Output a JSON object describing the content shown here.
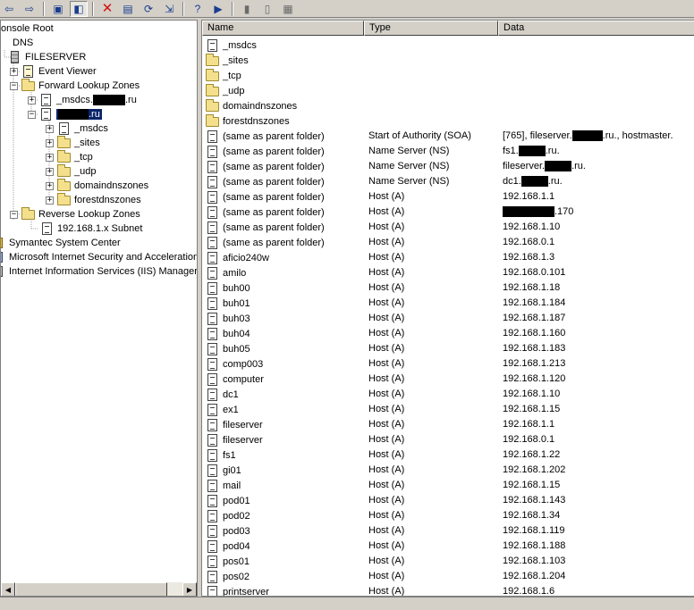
{
  "toolbar": {
    "buttons": [
      {
        "icon": "back-arrow-icon",
        "glyph": "⇦"
      },
      {
        "icon": "forward-arrow-icon",
        "glyph": "⇨"
      },
      {
        "icon": "up-one-level-icon",
        "glyph": "▣"
      },
      {
        "icon": "show-hide-console-tree-icon",
        "glyph": "◧"
      },
      {
        "icon": "delete-icon",
        "glyph": "✕"
      },
      {
        "icon": "properties-icon",
        "glyph": "▤"
      },
      {
        "icon": "refresh-icon",
        "glyph": "⟳"
      },
      {
        "icon": "export-list-icon",
        "glyph": "⇲"
      },
      {
        "icon": "help-icon",
        "glyph": "?"
      },
      {
        "icon": "action-pane-icon",
        "glyph": "▶"
      },
      {
        "icon": "new-host-icon",
        "glyph": "▮"
      },
      {
        "icon": "new-record-icon",
        "glyph": "▯"
      },
      {
        "icon": "new-zone-icon",
        "glyph": "▦"
      }
    ]
  },
  "tree": {
    "console_root": "onsole Root",
    "dns": "DNS",
    "server": "FILESERVER",
    "event_viewer": "Event Viewer",
    "forward_lookup_zones": "Forward Lookup Zones",
    "msdcs_zone_prefix": "_msdcs.",
    "msdcs_zone_suffix": ".ru",
    "selected_zone_suffix": ".ru",
    "sub_msdcs": "_msdcs",
    "sub_sites": "_sites",
    "sub_tcp": "_tcp",
    "sub_udp": "_udp",
    "sub_domaindnszones": "domaindnszones",
    "sub_forestdnszones": "forestdnszones",
    "reverse_lookup_zones": "Reverse Lookup Zones",
    "reverse_subnet": "192.168.1.x Subnet",
    "symantec": "Symantec System Center",
    "isa": "Microsoft Internet Security and Acceleration",
    "iis": "Internet Information Services (IIS) Manager"
  },
  "list": {
    "columns": {
      "name": "Name",
      "type": "Type",
      "data": "Data"
    },
    "rows": [
      {
        "name": "_msdcs",
        "icon": "zone",
        "type": "",
        "data": ""
      },
      {
        "name": "_sites",
        "icon": "folder",
        "type": "",
        "data": ""
      },
      {
        "name": "_tcp",
        "icon": "folder",
        "type": "",
        "data": ""
      },
      {
        "name": "_udp",
        "icon": "folder",
        "type": "",
        "data": ""
      },
      {
        "name": "domaindnszones",
        "icon": "folder",
        "type": "",
        "data": ""
      },
      {
        "name": "forestdnszones",
        "icon": "folder",
        "type": "",
        "data": ""
      },
      {
        "name": "(same as parent folder)",
        "icon": "record",
        "type": "Start of Authority (SOA)",
        "data": "[765], fileserver.",
        "data_after": ".ru., hostmaster.",
        "redact": 34
      },
      {
        "name": "(same as parent folder)",
        "icon": "record",
        "type": "Name Server (NS)",
        "data": "fs1.",
        "data_after": ".ru.",
        "redact": 30
      },
      {
        "name": "(same as parent folder)",
        "icon": "record",
        "type": "Name Server (NS)",
        "data": "fileserver.",
        "data_after": ".ru.",
        "redact": 30
      },
      {
        "name": "(same as parent folder)",
        "icon": "record",
        "type": "Name Server (NS)",
        "data": "dc1.",
        "data_after": ".ru.",
        "redact": 30
      },
      {
        "name": "(same as parent folder)",
        "icon": "record",
        "type": "Host (A)",
        "data": "192.168.1.1"
      },
      {
        "name": "(same as parent folder)",
        "icon": "record",
        "type": "Host (A)",
        "data": "",
        "data_after": ".170",
        "redact": 58
      },
      {
        "name": "(same as parent folder)",
        "icon": "record",
        "type": "Host (A)",
        "data": "192.168.1.10"
      },
      {
        "name": "(same as parent folder)",
        "icon": "record",
        "type": "Host (A)",
        "data": "192.168.0.1"
      },
      {
        "name": "aficio240w",
        "icon": "record",
        "type": "Host (A)",
        "data": "192.168.1.3"
      },
      {
        "name": "amilo",
        "icon": "record",
        "type": "Host (A)",
        "data": "192.168.0.101"
      },
      {
        "name": "buh00",
        "icon": "record",
        "type": "Host (A)",
        "data": "192.168.1.18"
      },
      {
        "name": "buh01",
        "icon": "record",
        "type": "Host (A)",
        "data": "192.168.1.184"
      },
      {
        "name": "buh03",
        "icon": "record",
        "type": "Host (A)",
        "data": "192.168.1.187"
      },
      {
        "name": "buh04",
        "icon": "record",
        "type": "Host (A)",
        "data": "192.168.1.160"
      },
      {
        "name": "buh05",
        "icon": "record",
        "type": "Host (A)",
        "data": "192.168.1.183"
      },
      {
        "name": "comp003",
        "icon": "record",
        "type": "Host (A)",
        "data": "192.168.1.213"
      },
      {
        "name": "computer",
        "icon": "record",
        "type": "Host (A)",
        "data": "192.168.1.120"
      },
      {
        "name": "dc1",
        "icon": "record",
        "type": "Host (A)",
        "data": "192.168.1.10"
      },
      {
        "name": "ex1",
        "icon": "record",
        "type": "Host (A)",
        "data": "192.168.1.15"
      },
      {
        "name": "fileserver",
        "icon": "record",
        "type": "Host (A)",
        "data": "192.168.1.1"
      },
      {
        "name": "fileserver",
        "icon": "record",
        "type": "Host (A)",
        "data": "192.168.0.1"
      },
      {
        "name": "fs1",
        "icon": "record",
        "type": "Host (A)",
        "data": "192.168.1.22"
      },
      {
        "name": "gi01",
        "icon": "record",
        "type": "Host (A)",
        "data": "192.168.1.202"
      },
      {
        "name": "mail",
        "icon": "record",
        "type": "Host (A)",
        "data": "192.168.1.15"
      },
      {
        "name": "pod01",
        "icon": "record",
        "type": "Host (A)",
        "data": "192.168.1.143"
      },
      {
        "name": "pod02",
        "icon": "record",
        "type": "Host (A)",
        "data": "192.168.1.34"
      },
      {
        "name": "pod03",
        "icon": "record",
        "type": "Host (A)",
        "data": "192.168.1.119"
      },
      {
        "name": "pod04",
        "icon": "record",
        "type": "Host (A)",
        "data": "192.168.1.188"
      },
      {
        "name": "pos01",
        "icon": "record",
        "type": "Host (A)",
        "data": "192.168.1.103"
      },
      {
        "name": "pos02",
        "icon": "record",
        "type": "Host (A)",
        "data": "192.168.1.204"
      },
      {
        "name": "printserver",
        "icon": "record",
        "type": "Host (A)",
        "data": "192.168.1.6"
      }
    ]
  }
}
